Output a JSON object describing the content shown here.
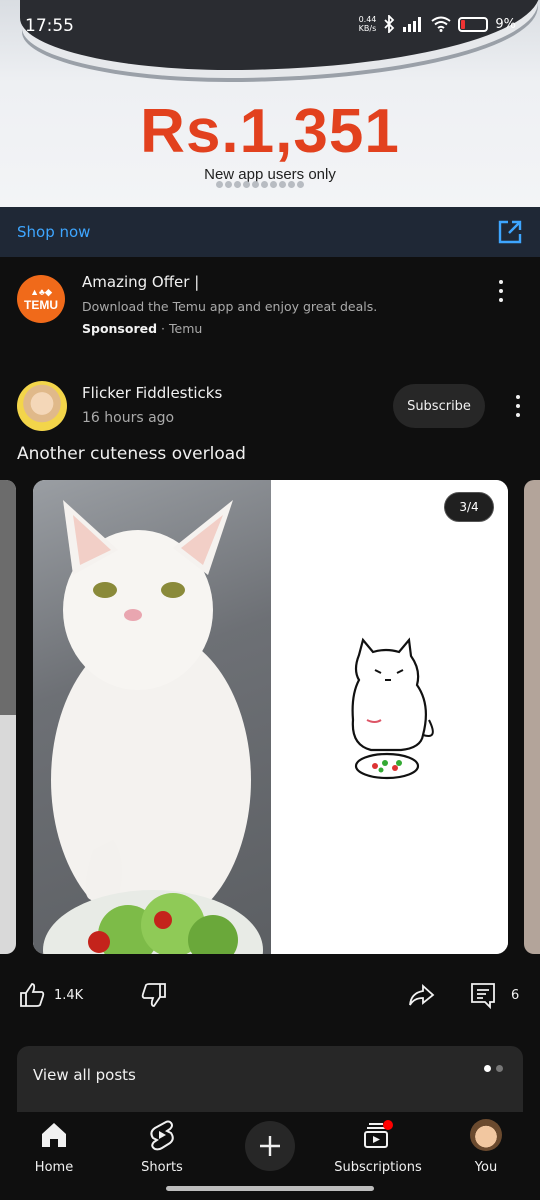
{
  "status_bar": {
    "time": "17:55",
    "net_speed_value": "0.44",
    "net_speed_unit": "KB/s",
    "battery": "9%"
  },
  "ad": {
    "price": "Rs.1,351",
    "subtitle": "New app users only",
    "carousel_dot_count": 10,
    "shop_label": "Shop now"
  },
  "sponsored": {
    "logo_text": "TEMU",
    "title": "Amazing Offer |",
    "description": "Download the Temu app and enjoy great deals.",
    "sponsored_label": "Sponsored",
    "separator": "·",
    "advertiser": "Temu"
  },
  "post": {
    "channel_name": "Flicker Fiddlesticks",
    "time_ago": "16 hours ago",
    "subscribe_label": "Subscribe",
    "text": "Another cuteness overload",
    "image_counter": "3/4",
    "likes": "1.4K",
    "comments": "6"
  },
  "view_all": {
    "label": "View all posts",
    "dots_total": 2,
    "dots_active": 1
  },
  "nav": {
    "home": "Home",
    "shorts": "Shorts",
    "subscriptions": "Subscriptions",
    "you": "You"
  },
  "colors": {
    "background": "#0f0f0f",
    "link_blue": "#3ea6ff",
    "temu_orange": "#f06a1a",
    "price_red": "#e2411e",
    "notification_red": "#ff0000"
  }
}
